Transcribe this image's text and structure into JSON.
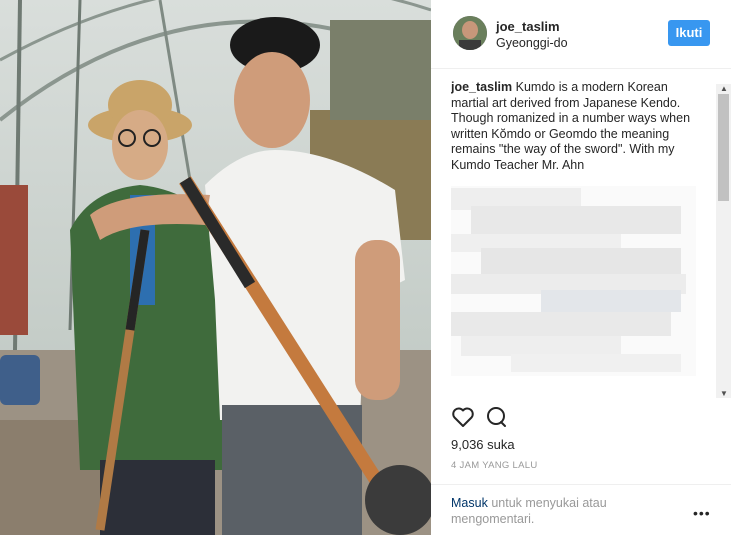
{
  "post": {
    "username": "joe_taslim",
    "location": "Gyeonggi-do",
    "follow_label": "Ikuti",
    "caption": "Kumdo is a modern Korean martial art derived from Japanese Kendo. Though romanized in a number ways when written Kŏmdo or Geomdo the meaning remains \"the way of the sword\". With my Kumdo Teacher Mr. Ahn",
    "likes": "9,036 suka",
    "time_ago": "4 JAM YANG LALU"
  },
  "footer": {
    "login_link": "Masuk",
    "login_text": "untuk menyukai atau mengomentari.",
    "more_label": "•••"
  },
  "icons": {
    "like": "heart-icon",
    "comment": "comment-icon",
    "more": "more-options-icon"
  },
  "colors": {
    "follow_button": "#3897f0",
    "login_link": "#003569",
    "muted_text": "#999999"
  }
}
